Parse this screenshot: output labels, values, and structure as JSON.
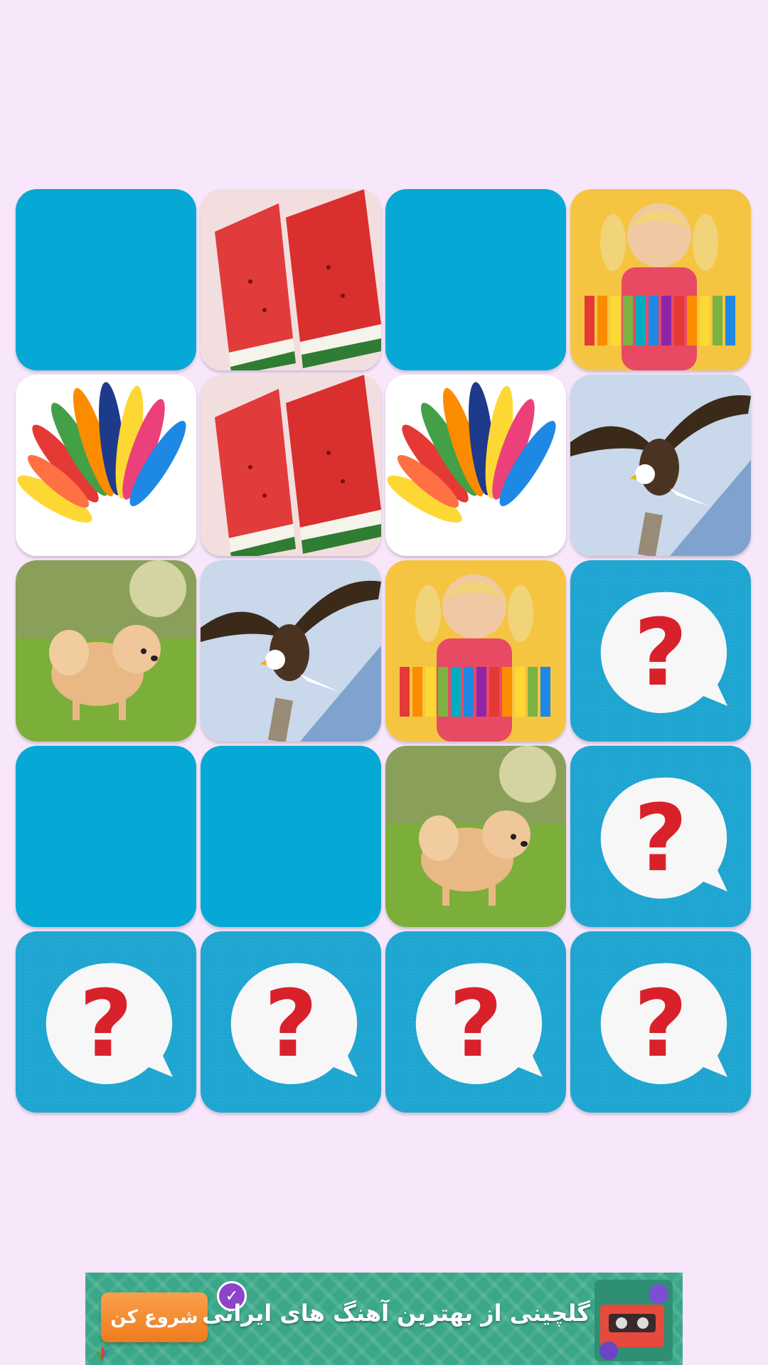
{
  "board": {
    "rows": [
      [
        "matched",
        "watermelon",
        "matched",
        "girl-xylophone"
      ],
      [
        "feathers",
        "watermelon",
        "feathers",
        "eagle"
      ],
      [
        "pomeranian-dog",
        "eagle",
        "girl-xylophone",
        "hidden"
      ],
      [
        "matched",
        "matched",
        "pomeranian-dog",
        "hidden"
      ],
      [
        "hidden",
        "hidden",
        "hidden",
        "hidden"
      ]
    ],
    "card_back_symbol": "?"
  },
  "ad": {
    "button_label": "شروع کن",
    "headline": "گلچینی از بهترین آهنگ های ایرانی",
    "badge_icon": "check-badge-icon",
    "thumbnail_icon": "cassette-icon"
  },
  "colors": {
    "background": "#f8e6fb",
    "card_blank": "#06a9d6",
    "card_back": "#1ea5d1",
    "question_mark": "#d9212b",
    "ad_background": "#3aa788",
    "ad_button": "#f28a2e"
  }
}
